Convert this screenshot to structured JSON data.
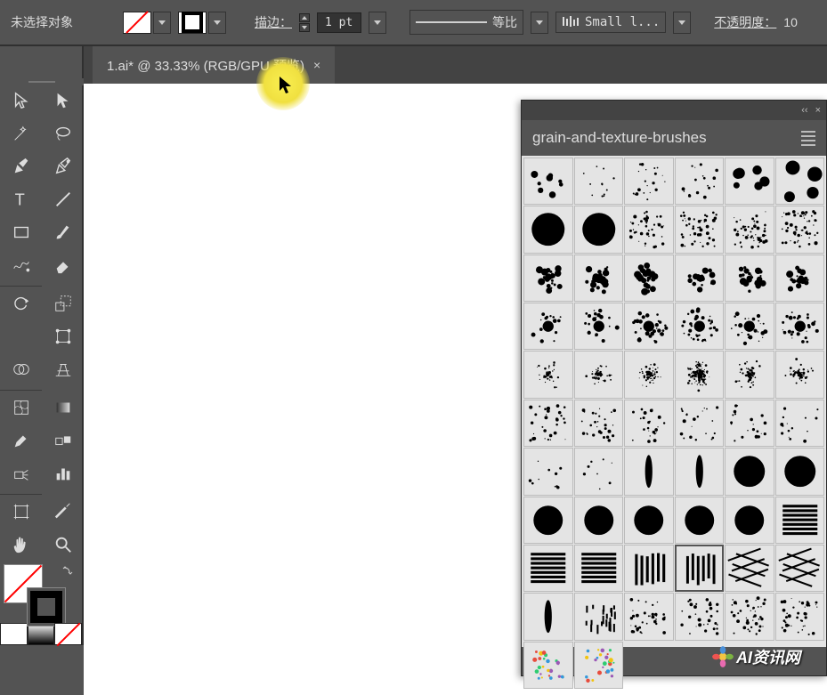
{
  "topbar": {
    "selection_status": "未选择对象",
    "stroke_label": "描边：",
    "stroke_weight": "1 pt",
    "profile_label": "等比",
    "brush_name": "Small l...",
    "opacity_label": "不透明度：",
    "opacity_value": "10"
  },
  "tab": {
    "title": "1.ai* @ 33.33% (RGB/GPU 预览)",
    "close": "×"
  },
  "panel": {
    "title": "grain-and-texture-brushes",
    "collapse": "‹‹",
    "close": "×"
  },
  "watermark": {
    "text": "AI资讯网"
  },
  "brushes": [
    "dots-sparse",
    "dots-tiny",
    "dots-fine",
    "dots-fine-2",
    "dots-medium",
    "dots-big",
    "blob-big-1",
    "blob-big-2",
    "speckle-1",
    "speckle-2",
    "speckle-3",
    "speckle-4",
    "splat-1",
    "splat-2",
    "splat-3",
    "splat-4",
    "splat-5",
    "splat-6",
    "star-1",
    "star-2",
    "burst-1",
    "burst-2",
    "burst-3",
    "burst-4",
    "spray-1",
    "spray-2",
    "spray-3",
    "spray-dense",
    "spray-4",
    "spray-5",
    "grain-1",
    "grain-2",
    "grain-3",
    "grain-4",
    "grain-5",
    "grain-6",
    "dash-1",
    "dash-2",
    "stroke-1",
    "stroke-2",
    "circle-1",
    "circle-2",
    "circle-3",
    "circle-4",
    "circle-5",
    "circle-6",
    "circle-7",
    "stripes-1",
    "stripes-2",
    "stripes-3",
    "bars-1",
    "bars-2",
    "weave-1",
    "weave-2",
    "smear-1",
    "ticks-1",
    "noise-1",
    "noise-2",
    "noise-3",
    "noise-4",
    "color-1",
    "color-2"
  ]
}
